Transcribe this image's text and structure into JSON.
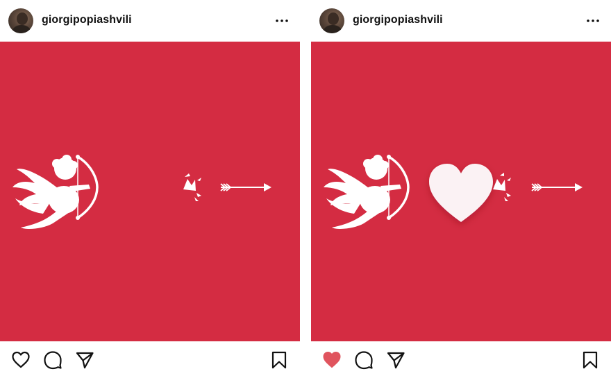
{
  "posts": [
    {
      "username": "giorgipopiashvili",
      "liked": false,
      "heart_visible": false
    },
    {
      "username": "giorgipopiashvili",
      "liked": true,
      "heart_visible": true
    }
  ],
  "colors": {
    "background": "#d42c42",
    "like_active": "#e0545e",
    "icon": "#111111",
    "heart_fill": "#fbf2f4"
  },
  "icons": [
    "more-icon",
    "heart-icon",
    "comment-icon",
    "share-icon",
    "bookmark-icon"
  ]
}
